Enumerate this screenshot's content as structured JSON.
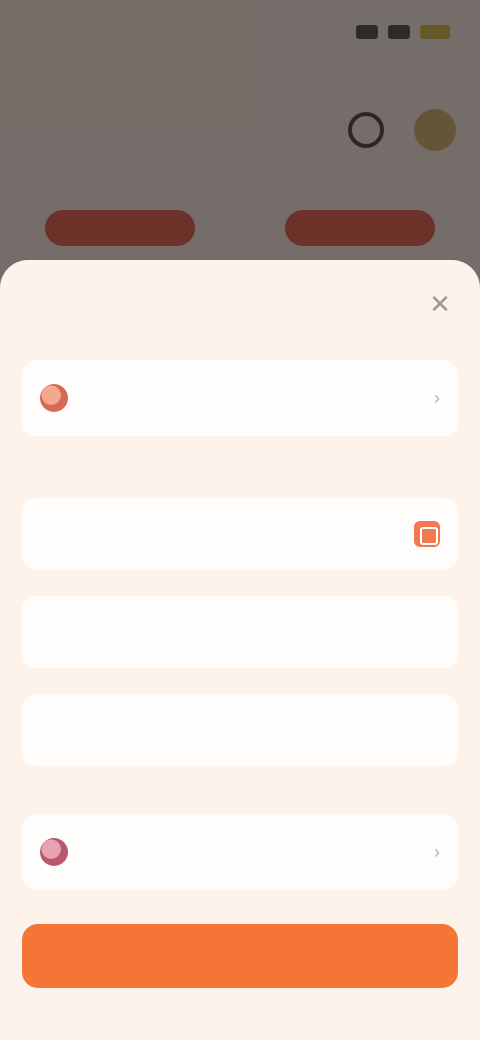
{
  "status_bar": {
    "time": "",
    "icons": [
      "signal-icon",
      "wifi-icon",
      "battery-icon"
    ]
  },
  "background_app": {
    "title": "",
    "actions": [
      "search-icon",
      "profile-icon"
    ],
    "tabs": [
      "",
      ""
    ]
  },
  "sheet": {
    "title": "",
    "close_icon": "close-icon",
    "from": {
      "label": "",
      "value": "",
      "icon": "coin-icon"
    },
    "section_label": "",
    "recipient": {
      "placeholder": "",
      "icon": "scan-icon"
    },
    "amount": {
      "placeholder": ""
    },
    "note": {
      "placeholder": ""
    },
    "to": {
      "label": "",
      "value": "",
      "icon": "coin-icon"
    },
    "submit_label": ""
  },
  "colors": {
    "accent": "#f47536",
    "sheet_background": "#fdf3ea",
    "card_background": "#fffdfb"
  }
}
